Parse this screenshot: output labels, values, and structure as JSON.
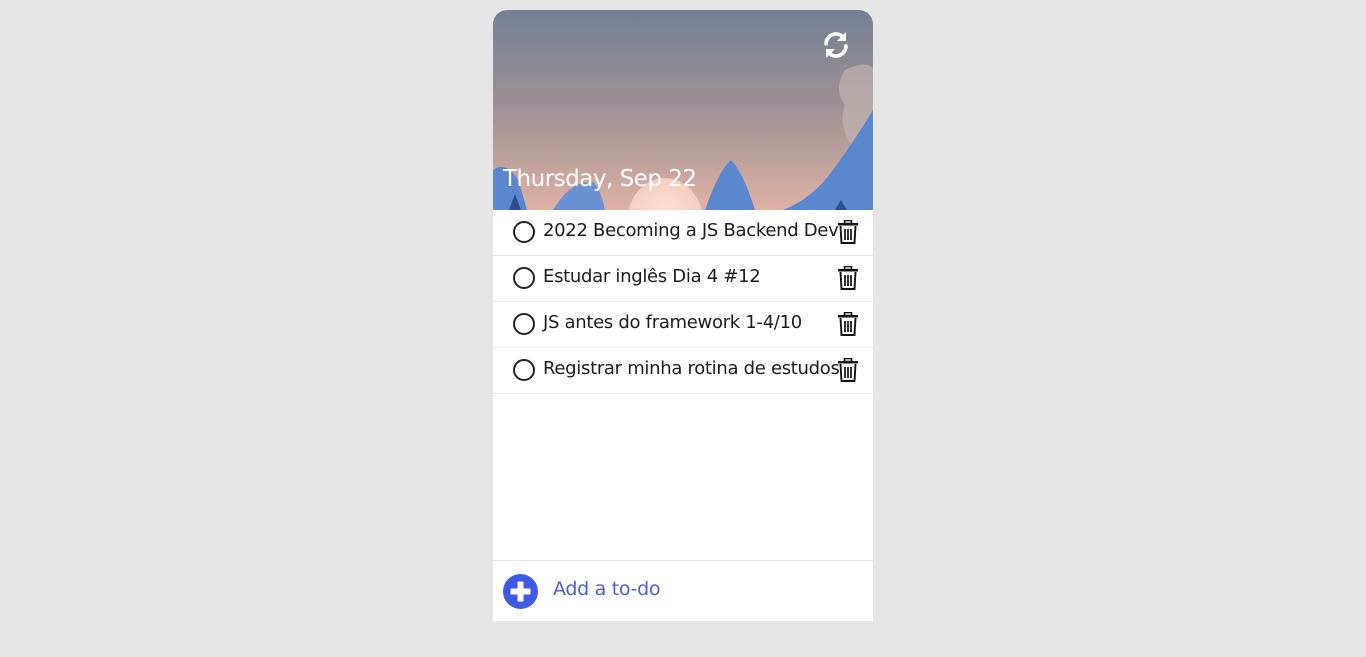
{
  "header": {
    "date": "Thursday, Sep 22",
    "refresh_icon": "refresh-icon"
  },
  "todos": [
    {
      "text": "2022 Becoming a JS Backend Dev",
      "done": false
    },
    {
      "text": "Estudar inglês Dia 4 #12",
      "done": false
    },
    {
      "text": "JS antes do framework 1-4/10",
      "done": false
    },
    {
      "text": "Registrar minha rotina de estudos",
      "done": false
    }
  ],
  "footer": {
    "add_label": "Add a to-do",
    "add_icon": "plus-circle-icon"
  },
  "colors": {
    "page_background": "#e5e5e5",
    "accent": "#4a5ed6",
    "sky_top": "#747f93",
    "sky_bottom": "#e5b6a8",
    "mountains": "#5b87cf"
  }
}
